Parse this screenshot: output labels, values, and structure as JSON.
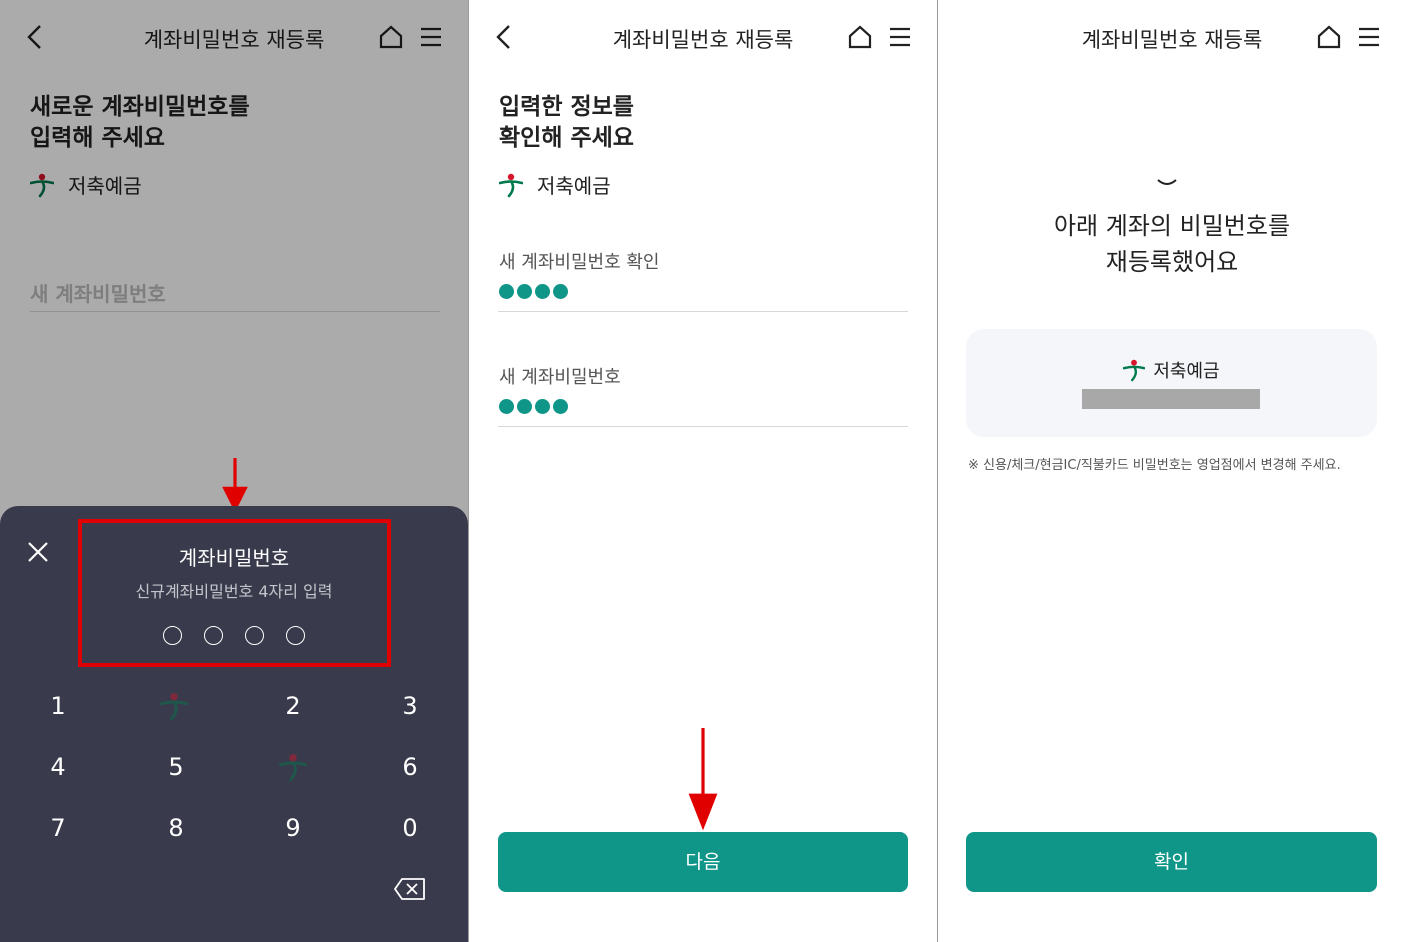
{
  "header": {
    "title": "계좌비밀번호 재등록"
  },
  "screen1": {
    "title_line1": "새로운 계좌비밀번호를",
    "title_line2": "입력해 주세요",
    "account_name": "저축예금",
    "field_placeholder": "새 계좌비밀번호",
    "keypad": {
      "title": "계좌비밀번호",
      "subtitle": "신규계좌비밀번호 4자리 입력",
      "pin_length": 4,
      "keys": [
        "1",
        "2",
        "3",
        "4",
        "5",
        "6",
        "7",
        "8",
        "9",
        "0"
      ]
    }
  },
  "screen2": {
    "title_line1": "입력한 정보를",
    "title_line2": "확인해 주세요",
    "account_name": "저축예금",
    "confirm_label": "새 계좌비밀번호 확인",
    "new_label": "새 계좌비밀번호",
    "masked_digits": 4,
    "next_button": "다음"
  },
  "screen3": {
    "title_line1": "아래 계좌의 비밀번호를",
    "title_line2": "재등록했어요",
    "account_name": "저축예금",
    "note": "※ 신용/체크/현금IC/직불카드 비밀번호는 영업점에서 변경해 주세요.",
    "confirm_button": "확인"
  },
  "colors": {
    "accent": "#0f9688",
    "highlight": "#e00000",
    "keypad_bg": "#393a4b"
  },
  "icons": [
    "back-icon",
    "home-icon",
    "menu-icon",
    "bank-logo-icon",
    "close-icon",
    "backspace-icon",
    "arrow-down-icon"
  ]
}
